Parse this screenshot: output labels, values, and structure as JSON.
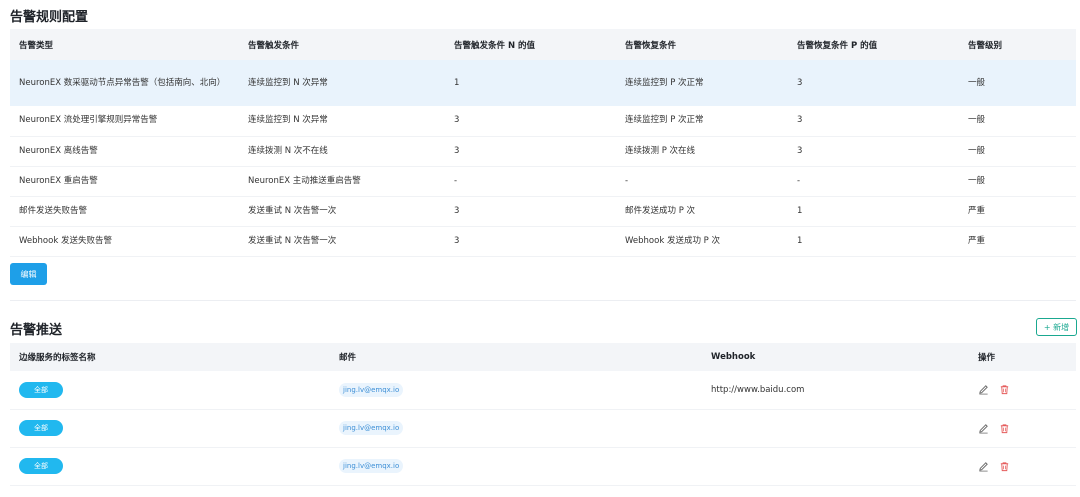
{
  "rules_section": {
    "title": "告警规则配置",
    "columns": [
      "告警类型",
      "告警触发条件",
      "告警触发条件 N 的值",
      "告警恢复条件",
      "告警恢复条件 P 的值",
      "告警级别"
    ],
    "rows": [
      [
        "NeuronEX 数采驱动节点异常告警（包括南向、北向）",
        "连续监控到 N 次异常",
        "1",
        "连续监控到 P 次正常",
        "3",
        "一般"
      ],
      [
        "NeuronEX 流处理引擎规则异常告警",
        "连续监控到 N 次异常",
        "3",
        "连续监控到 P 次正常",
        "3",
        "一般"
      ],
      [
        "NeuronEX 离线告警",
        "连续拨测 N 次不在线",
        "3",
        "连续拨测 P 次在线",
        "3",
        "一般"
      ],
      [
        "NeuronEX 重启告警",
        "NeuronEX 主动推送重启告警",
        "-",
        "-",
        "-",
        "一般"
      ],
      [
        "邮件发送失败告警",
        "发送重试 N 次告警一次",
        "3",
        "邮件发送成功 P 次",
        "1",
        "严重"
      ],
      [
        "Webhook 发送失败告警",
        "发送重试 N 次告警一次",
        "3",
        "Webhook 发送成功 P 次",
        "1",
        "严重"
      ]
    ],
    "edit_label": "编辑"
  },
  "push_section": {
    "title": "告警推送",
    "add_label": "+ 新增",
    "columns": [
      "边缘服务的标签名称",
      "邮件",
      "Webhook",
      "操作"
    ],
    "rows": [
      {
        "tag": "全部",
        "email": "jing.lv@emqx.io",
        "webhook": "http://www.baidu.com"
      },
      {
        "tag": "全部",
        "email": "jing.lv@emqx.io",
        "webhook": ""
      },
      {
        "tag": "全部",
        "email": "jing.lv@emqx.io",
        "webhook": ""
      }
    ]
  },
  "icons": {
    "edit": "pencil-icon",
    "delete": "trash-icon"
  },
  "colors": {
    "primary": "#1e9fe8",
    "tag": "#21b8ef",
    "add_border": "#1aa890",
    "delete": "#e55b5b",
    "selected_row": "#e9f3fc"
  }
}
